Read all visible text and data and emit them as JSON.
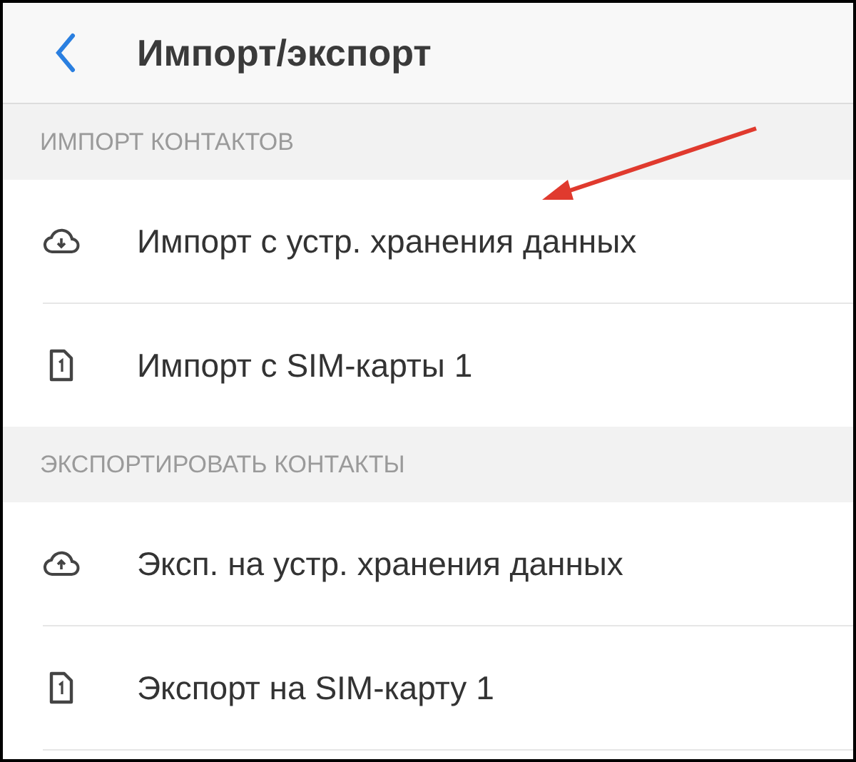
{
  "header": {
    "title": "Импорт/экспорт"
  },
  "sections": [
    {
      "title": "ИМПОРТ КОНТАКТОВ",
      "items": [
        {
          "kind": "download",
          "label": "Импорт с устр. хранения данных"
        },
        {
          "kind": "sim",
          "label": "Импорт с SIM-карты 1"
        }
      ]
    },
    {
      "title": "ЭКСПОРТИРОВАТЬ КОНТАКТЫ",
      "items": [
        {
          "kind": "upload",
          "label": "Эксп. на устр. хранения данных"
        },
        {
          "kind": "sim",
          "label": "Экспорт на SIM-карту 1"
        }
      ]
    }
  ]
}
